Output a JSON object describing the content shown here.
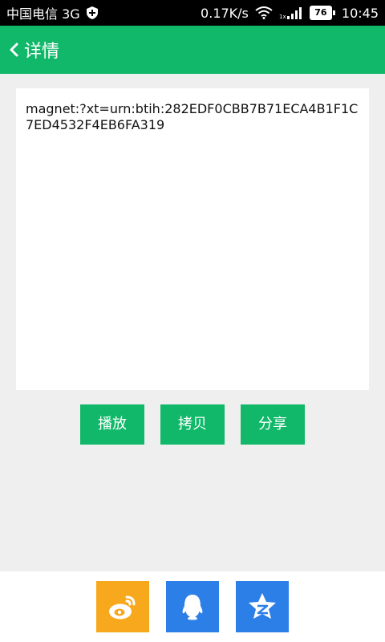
{
  "status_bar": {
    "carrier": "中国电信 3G",
    "net_speed": "0.17K/s",
    "signal_label": "1x",
    "battery_level": "76",
    "time": "10:45"
  },
  "header": {
    "title": "详情"
  },
  "content": {
    "magnet_link": "magnet:?xt=urn:btih:282EDF0CBB7B71ECA4B1F1C7ED4532F4EB6FA319"
  },
  "actions": {
    "play_label": "播放",
    "copy_label": "拷贝",
    "share_label": "分享"
  },
  "share_targets": [
    {
      "icon": "weibo-icon",
      "color": "#f7a81c"
    },
    {
      "icon": "qq-icon",
      "color": "#2d7fe8"
    },
    {
      "icon": "qzone-icon",
      "color": "#2d7fe8"
    }
  ],
  "colors": {
    "accent": "#11b869",
    "background": "#efefef"
  }
}
